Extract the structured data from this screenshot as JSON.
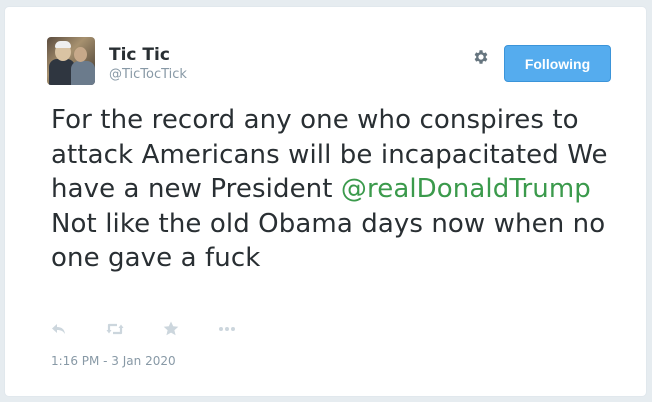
{
  "user": {
    "display_name": "Tic Tic",
    "handle": "@TicTocTick"
  },
  "header": {
    "follow_button_label": "Following",
    "settings_icon": "gear-icon"
  },
  "tweet": {
    "text_before_mention": "For the record any one who conspires to attack Americans will be incapacitated We have a new President ",
    "mention": "@realDonaldTrump",
    "text_after_mention": " Not like the old Obama days now when no one gave a fuck",
    "timestamp": "1:16 PM - 3 Jan 2020"
  },
  "actions": [
    {
      "icon": "reply-icon"
    },
    {
      "icon": "retweet-icon"
    },
    {
      "icon": "like-star-icon"
    },
    {
      "icon": "more-dots-icon"
    }
  ],
  "colors": {
    "button_blue": "#55acee",
    "mention_green": "#3b9a4c",
    "text": "#292f33",
    "muted": "#8899a6",
    "action_icon": "#ccd6dd"
  }
}
